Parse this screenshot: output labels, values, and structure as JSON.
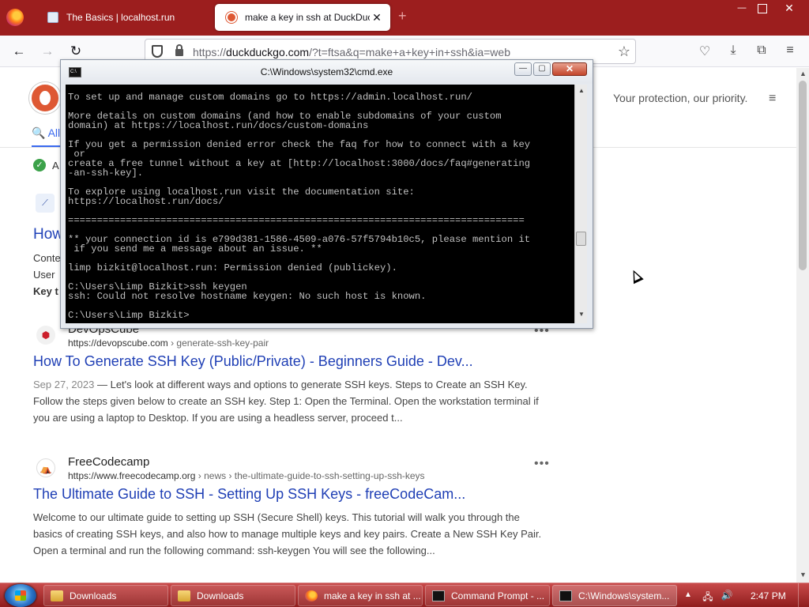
{
  "browser": {
    "tabs": [
      {
        "label": "The Basics | localhost.run",
        "active": false
      },
      {
        "label": "make a key in ssh at DuckDuckGo",
        "active": true
      }
    ],
    "new_tab": "+",
    "url_prefix": "https://",
    "url_host": "duckduckgo.com",
    "url_rest": "/?t=ftsa&q=make+a+key+in+ssh&ia=web",
    "close_tab_glyph": "✕"
  },
  "page": {
    "protection_text": "Your protection, our priority.",
    "tab_all": "All",
    "check_text": "A",
    "partial_result": {
      "title": "How",
      "snippet_lines": [
        "Conte",
        "User",
        "Key t"
      ]
    },
    "results": [
      {
        "source": "DevOpsCube",
        "url_host": "https://devopscube.com",
        "url_path": "› generate-ssh-key-pair",
        "title": "How To Generate SSH Key (Public/Private) - Beginners Guide - Dev...",
        "date": "Sep 27, 2023",
        "snippet": "Let's look at different ways and options to generate SSH keys. Steps to Create an SSH Key. Follow the steps given below to create an SSH key. Step 1: Open the Terminal. Open the workstation terminal if you are using a laptop to Desktop. If you are using a headless server, proceed t..."
      },
      {
        "source": "FreeCodecamp",
        "url_host": "https://www.freecodecamp.org",
        "url_path": "› news › the-ultimate-guide-to-ssh-setting-up-ssh-keys",
        "title": "The Ultimate Guide to SSH - Setting Up SSH Keys - freeCodeCam...",
        "date": "",
        "snippet": "Welcome to our ultimate guide to setting up SSH (Secure Shell) keys. This tutorial will walk you through the basics of creating SSH keys, and also how to manage multiple keys and key pairs. Create a New SSH Key Pair. Open a terminal and run the following command: ssh-keygen You will see the following..."
      }
    ]
  },
  "cmd": {
    "title": "C:\\Windows\\system32\\cmd.exe",
    "console_text": "To set up and manage custom domains go to https://admin.localhost.run/\n\nMore details on custom domains (and how to enable subdomains of your custom\ndomain) at https://localhost.run/docs/custom-domains\n\nIf you get a permission denied error check the faq for how to connect with a key\n or\ncreate a free tunnel without a key at [http://localhost:3000/docs/faq#generating\n-an-ssh-key].\n\nTo explore using localhost.run visit the documentation site:\nhttps://localhost.run/docs/\n\n===============================================================================\n\n** your connection id is e799d381-1586-4509-a076-57f5794b10c5, please mention it\n if you send me a message about an issue. **\n\nlimp bizkit@localhost.run: Permission denied (publickey).\n\nC:\\Users\\Limp Bizkit>ssh keygen\nssh: Could not resolve hostname keygen: No such host is known.\n\nC:\\Users\\Limp Bizkit>"
  },
  "taskbar": {
    "buttons": [
      {
        "label": "Downloads",
        "icon": "folder-icon"
      },
      {
        "label": "Downloads",
        "icon": "folder-icon"
      },
      {
        "label": "make a key in ssh at ...",
        "icon": "firefox-icon"
      },
      {
        "label": "Command Prompt - ...",
        "icon": "cmd-icon"
      },
      {
        "label": "C:\\Windows\\system...",
        "icon": "cmd-icon"
      }
    ],
    "clock": "2:47 PM"
  },
  "colors": {
    "accent_red": "#9c1e1e",
    "ddg_link": "#1f3fb5",
    "ddg_orange": "#de5833"
  }
}
